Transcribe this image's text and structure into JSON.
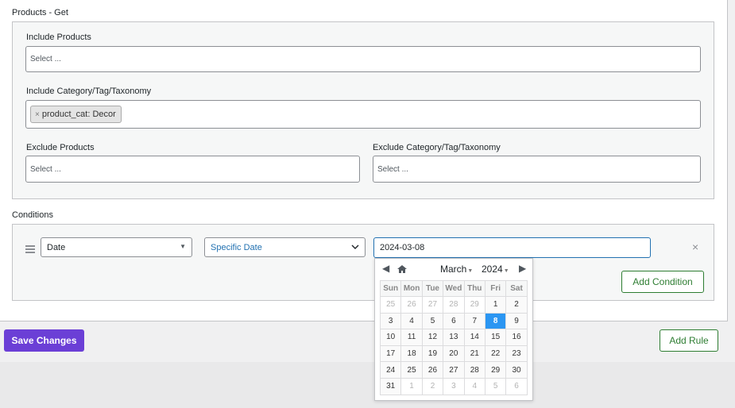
{
  "products_get": {
    "title": "Products - Get",
    "include_products": {
      "label": "Include Products",
      "placeholder": "Select ..."
    },
    "include_taxonomy": {
      "label": "Include Category/Tag/Taxonomy",
      "chip_remove": "×",
      "chip": "product_cat: Decor"
    },
    "exclude_products": {
      "label": "Exclude Products",
      "placeholder": "Select ..."
    },
    "exclude_taxonomy": {
      "label": "Exclude Category/Tag/Taxonomy",
      "placeholder": "Select ..."
    }
  },
  "conditions": {
    "title": "Conditions",
    "type_value": "Date",
    "mode_value": "Specific Date",
    "date_value": "2024-03-08",
    "remove": "×",
    "add_condition": "Add Condition"
  },
  "datepicker": {
    "month": "March",
    "year": "2024",
    "weekdays": [
      "Sun",
      "Mon",
      "Tue",
      "Wed",
      "Thu",
      "Fri",
      "Sat"
    ],
    "weeks": [
      [
        "25",
        "26",
        "27",
        "28",
        "29",
        "1",
        "2"
      ],
      [
        "3",
        "4",
        "5",
        "6",
        "7",
        "8",
        "9"
      ],
      [
        "10",
        "11",
        "12",
        "13",
        "14",
        "15",
        "16"
      ],
      [
        "17",
        "18",
        "19",
        "20",
        "21",
        "22",
        "23"
      ],
      [
        "24",
        "25",
        "26",
        "27",
        "28",
        "29",
        "30"
      ],
      [
        "31",
        "1",
        "2",
        "3",
        "4",
        "5",
        "6"
      ]
    ],
    "selected_day": "8",
    "accent": "#2b96f2"
  },
  "actions": {
    "save": "Save Changes",
    "add_rule": "Add Rule"
  },
  "colors": {
    "primary": "#6b3fd6",
    "success": "#2e7d32",
    "focus": "#2271b1"
  }
}
